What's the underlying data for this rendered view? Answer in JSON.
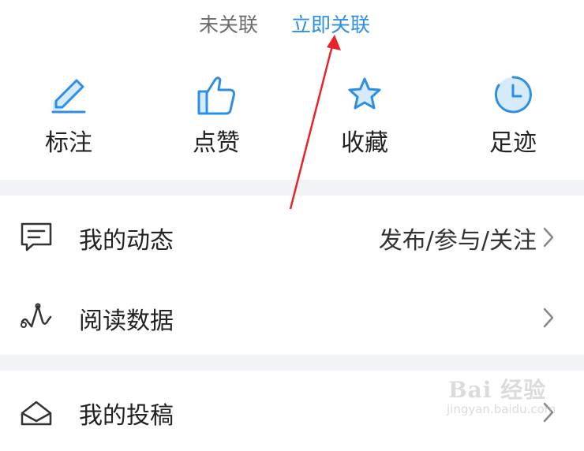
{
  "association": {
    "status_text": "未关联",
    "link_text": "立即关联"
  },
  "quick_actions": [
    {
      "label": "标注",
      "icon": "pencil-icon"
    },
    {
      "label": "点赞",
      "icon": "thumbs-up-icon"
    },
    {
      "label": "收藏",
      "icon": "star-icon"
    },
    {
      "label": "足迹",
      "icon": "history-clock-icon"
    }
  ],
  "menu": [
    {
      "label": "我的动态",
      "extra": "发布/参与/关注",
      "icon": "message-icon"
    },
    {
      "label": "阅读数据",
      "extra": "",
      "icon": "pulse-chart-icon"
    },
    {
      "label": "我的投稿",
      "extra": "",
      "icon": "envelope-icon"
    }
  ],
  "watermark": {
    "logo": "Bai 经验",
    "sub": "jingyan.baidu.com"
  },
  "colors": {
    "accent": "#2d8ee6",
    "icon_fill": "#d6ebfa",
    "separator": "#f1f3f6",
    "annotation_arrow": "#e8232a"
  }
}
